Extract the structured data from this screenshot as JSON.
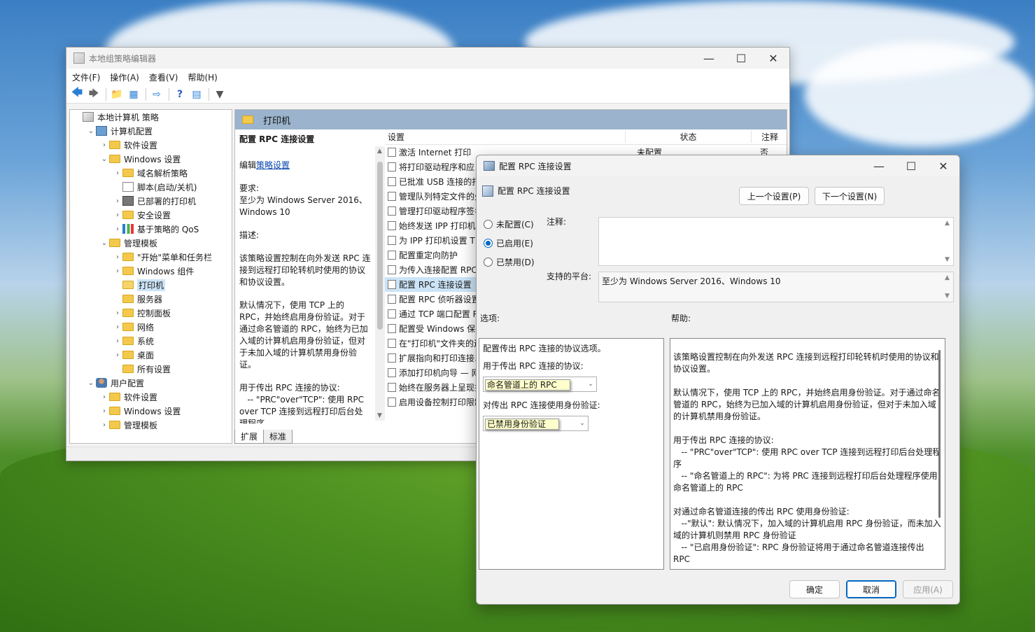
{
  "main_window": {
    "title": "本地组策略编辑器",
    "menu": [
      "文件(F)",
      "操作(A)",
      "查看(V)",
      "帮助(H)"
    ]
  },
  "tree": [
    {
      "label": "本地计算机 策略",
      "level": 0,
      "chev": "",
      "icon": "policy"
    },
    {
      "label": "计算机配置",
      "level": 1,
      "chev": "v",
      "icon": "computer"
    },
    {
      "label": "软件设置",
      "level": 2,
      "chev": ">",
      "icon": "folder"
    },
    {
      "label": "Windows 设置",
      "level": 2,
      "chev": "v",
      "icon": "folder"
    },
    {
      "label": "域名解析策略",
      "level": 3,
      "chev": ">",
      "icon": "folder"
    },
    {
      "label": "脚本(启动/关机)",
      "level": 3,
      "chev": "",
      "icon": "script"
    },
    {
      "label": "已部署的打印机",
      "level": 3,
      "chev": ">",
      "icon": "printer"
    },
    {
      "label": "安全设置",
      "level": 3,
      "chev": ">",
      "icon": "folder"
    },
    {
      "label": "基于策略的 QoS",
      "level": 3,
      "chev": ">",
      "icon": "chart"
    },
    {
      "label": "管理模板",
      "level": 2,
      "chev": "v",
      "icon": "folder"
    },
    {
      "label": "\"开始\"菜单和任务栏",
      "level": 3,
      "chev": ">",
      "icon": "folder"
    },
    {
      "label": "Windows 组件",
      "level": 3,
      "chev": ">",
      "icon": "folder"
    },
    {
      "label": "打印机",
      "level": 3,
      "chev": "",
      "icon": "folder-open"
    },
    {
      "label": "服务器",
      "level": 3,
      "chev": "",
      "icon": "folder"
    },
    {
      "label": "控制面板",
      "level": 3,
      "chev": ">",
      "icon": "folder"
    },
    {
      "label": "网络",
      "level": 3,
      "chev": ">",
      "icon": "folder"
    },
    {
      "label": "系统",
      "level": 3,
      "chev": ">",
      "icon": "folder"
    },
    {
      "label": "桌面",
      "level": 3,
      "chev": ">",
      "icon": "folder"
    },
    {
      "label": "所有设置",
      "level": 3,
      "chev": "",
      "icon": "folder"
    },
    {
      "label": "用户配置",
      "level": 1,
      "chev": "v",
      "icon": "user"
    },
    {
      "label": "软件设置",
      "level": 2,
      "chev": ">",
      "icon": "folder"
    },
    {
      "label": "Windows 设置",
      "level": 2,
      "chev": ">",
      "icon": "folder"
    },
    {
      "label": "管理模板",
      "level": 2,
      "chev": ">",
      "icon": "folder"
    }
  ],
  "right_header": "打印机",
  "description": {
    "title": "配置 RPC 连接设置",
    "edit_prefix": "编辑",
    "edit_link": "策略设置",
    "req_label": "要求:",
    "req_value": "至少为 Windows Server 2016、Windows 10",
    "desc_label": "描述:",
    "para1": "该策略设置控制在向外发送 RPC 连接到远程打印轮转机时使用的协议和协议设置。",
    "para2": "默认情况下，使用 TCP 上的 RPC，并始终启用身份验证。对于通过命名管道的 RPC，始终为已加入域的计算机启用身份验证，但对于未加入域的计算机禁用身份验证。",
    "para3": "用于传出 RPC 连接的协议:",
    "para4": "-- \"PRC\"over\"TCP\": 使用 RPC over TCP 连接到远程打印后台处理程序"
  },
  "list_columns": {
    "c1": "设置",
    "c2": "状态",
    "c3": "注释"
  },
  "list_rows": [
    {
      "name": "激活 Internet 打印",
      "state": "未配置",
      "note": "否"
    },
    {
      "name": "将打印驱动程序和应",
      "state": "",
      "note": ""
    },
    {
      "name": "已批准 USB 连接的打",
      "state": "",
      "note": ""
    },
    {
      "name": "管理队列特定文件的处",
      "state": "",
      "note": ""
    },
    {
      "name": "管理打印驱动程序签名",
      "state": "",
      "note": ""
    },
    {
      "name": "始终发送 IPP 打印机",
      "state": "",
      "note": ""
    },
    {
      "name": "为 IPP 打印机设置 T",
      "state": "",
      "note": ""
    },
    {
      "name": "配置重定向防护",
      "state": "",
      "note": ""
    },
    {
      "name": "为传入连接配置 RPC",
      "state": "",
      "note": ""
    },
    {
      "name": "配置 RPC 连接设置",
      "state": "",
      "note": "",
      "selected": true
    },
    {
      "name": "配置 RPC 侦听器设置",
      "state": "",
      "note": ""
    },
    {
      "name": "通过 TCP 端口配置 R",
      "state": "",
      "note": ""
    },
    {
      "name": "配置受 Windows 保护",
      "state": "",
      "note": ""
    },
    {
      "name": "在\"打印机\"文件夹的边",
      "state": "",
      "note": ""
    },
    {
      "name": "扩展指向和打印连接以",
      "state": "",
      "note": ""
    },
    {
      "name": "添加打印机向导 — 网",
      "state": "",
      "note": ""
    },
    {
      "name": "始终在服务器上呈现打",
      "state": "",
      "note": ""
    },
    {
      "name": "启用设备控制打印限制",
      "state": "",
      "note": ""
    }
  ],
  "tabs": [
    "扩展",
    "标准"
  ],
  "dialog": {
    "title": "配置 RPC 连接设置",
    "subtitle": "配置 RPC 连接设置",
    "prev_btn": "上一个设置(P)",
    "next_btn": "下一个设置(N)",
    "radio_notconfigured": "未配置(C)",
    "radio_enabled": "已启用(E)",
    "radio_disabled": "已禁用(D)",
    "comment_label": "注释:",
    "platform_label": "支持的平台:",
    "platform_value": "至少为 Windows Server 2016、Windows 10",
    "options_label": "选项:",
    "help_label": "帮助:",
    "opt_title": "配置传出 RPC 连接的协议选项。",
    "opt_protocol_label": "用于传出 RPC 连接的协议:",
    "opt_protocol_value": "命名管道上的 RPC",
    "opt_auth_label": "对传出 RPC 连接使用身份验证:",
    "opt_auth_value": "已禁用身份验证",
    "help_p1": "该策略设置控制在向外发送 RPC 连接到远程打印轮转机时使用的协议和协议设置。",
    "help_p2": "默认情况下，使用 TCP 上的 RPC，并始终启用身份验证。对于通过命名管道的 RPC，始终为已加入域的计算机启用身份验证，但对于未加入域的计算机禁用身份验证。",
    "help_p3a": "用于传出 RPC 连接的协议:",
    "help_p3b": "-- \"PRC\"over\"TCP\": 使用 RPC over TCP 连接到远程打印后台处理程序",
    "help_p3c": "-- \"命名管道上的 RPC\": 为将 PRC 连接到远程打印后台处理程序使用命名管道上的 RPC",
    "help_p4a": "对通过命名管道连接的传出 RPC 使用身份验证:",
    "help_p4b": "--\"默认\": 默认情况下，加入域的计算机启用 RPC 身份验证，而未加入域的计算机则禁用 RPC 身份验证",
    "help_p4c": "-- \"已启用身份验证\": RPC 身份验证将用于通过命名管道连接传出 RPC",
    "ok_btn": "确定",
    "cancel_btn": "取消",
    "apply_btn": "应用(A)"
  }
}
